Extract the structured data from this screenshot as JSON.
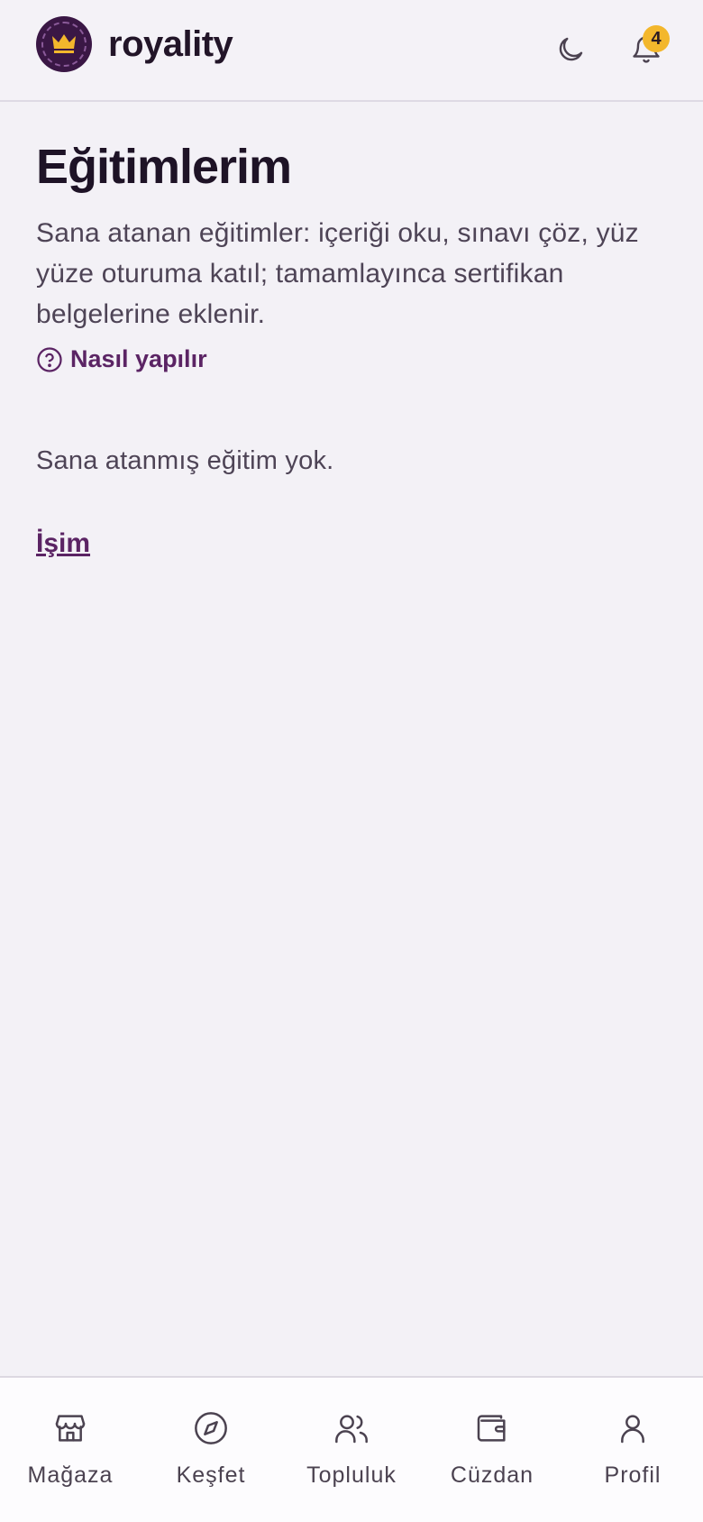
{
  "app": {
    "brand": "royality"
  },
  "header": {
    "theme_icon": "moon-icon",
    "notifications_icon": "bell-icon",
    "notification_count": "4",
    "badge_color": "#f3b72c"
  },
  "main": {
    "title": "Eğitimlerim",
    "description": "Sana atanan eğitimler: içeriği oku, sınavı çöz, yüz yüze oturuma katıl; tamamlayınca sertifikan belgelerine eklenir.",
    "howto_label": "Nasıl yapılır",
    "empty_text": "Sana atanmış eğitim yok.",
    "link_label": "İşim"
  },
  "nav": {
    "items": [
      {
        "label": "Mağaza",
        "icon": "store-icon"
      },
      {
        "label": "Keşfet",
        "icon": "compass-icon"
      },
      {
        "label": "Topluluk",
        "icon": "users-icon"
      },
      {
        "label": "Cüzdan",
        "icon": "wallet-icon"
      },
      {
        "label": "Profil",
        "icon": "user-icon"
      }
    ]
  },
  "colors": {
    "accent": "#5b2464",
    "background": "#f3f1f6",
    "logo": "#3a1745"
  }
}
